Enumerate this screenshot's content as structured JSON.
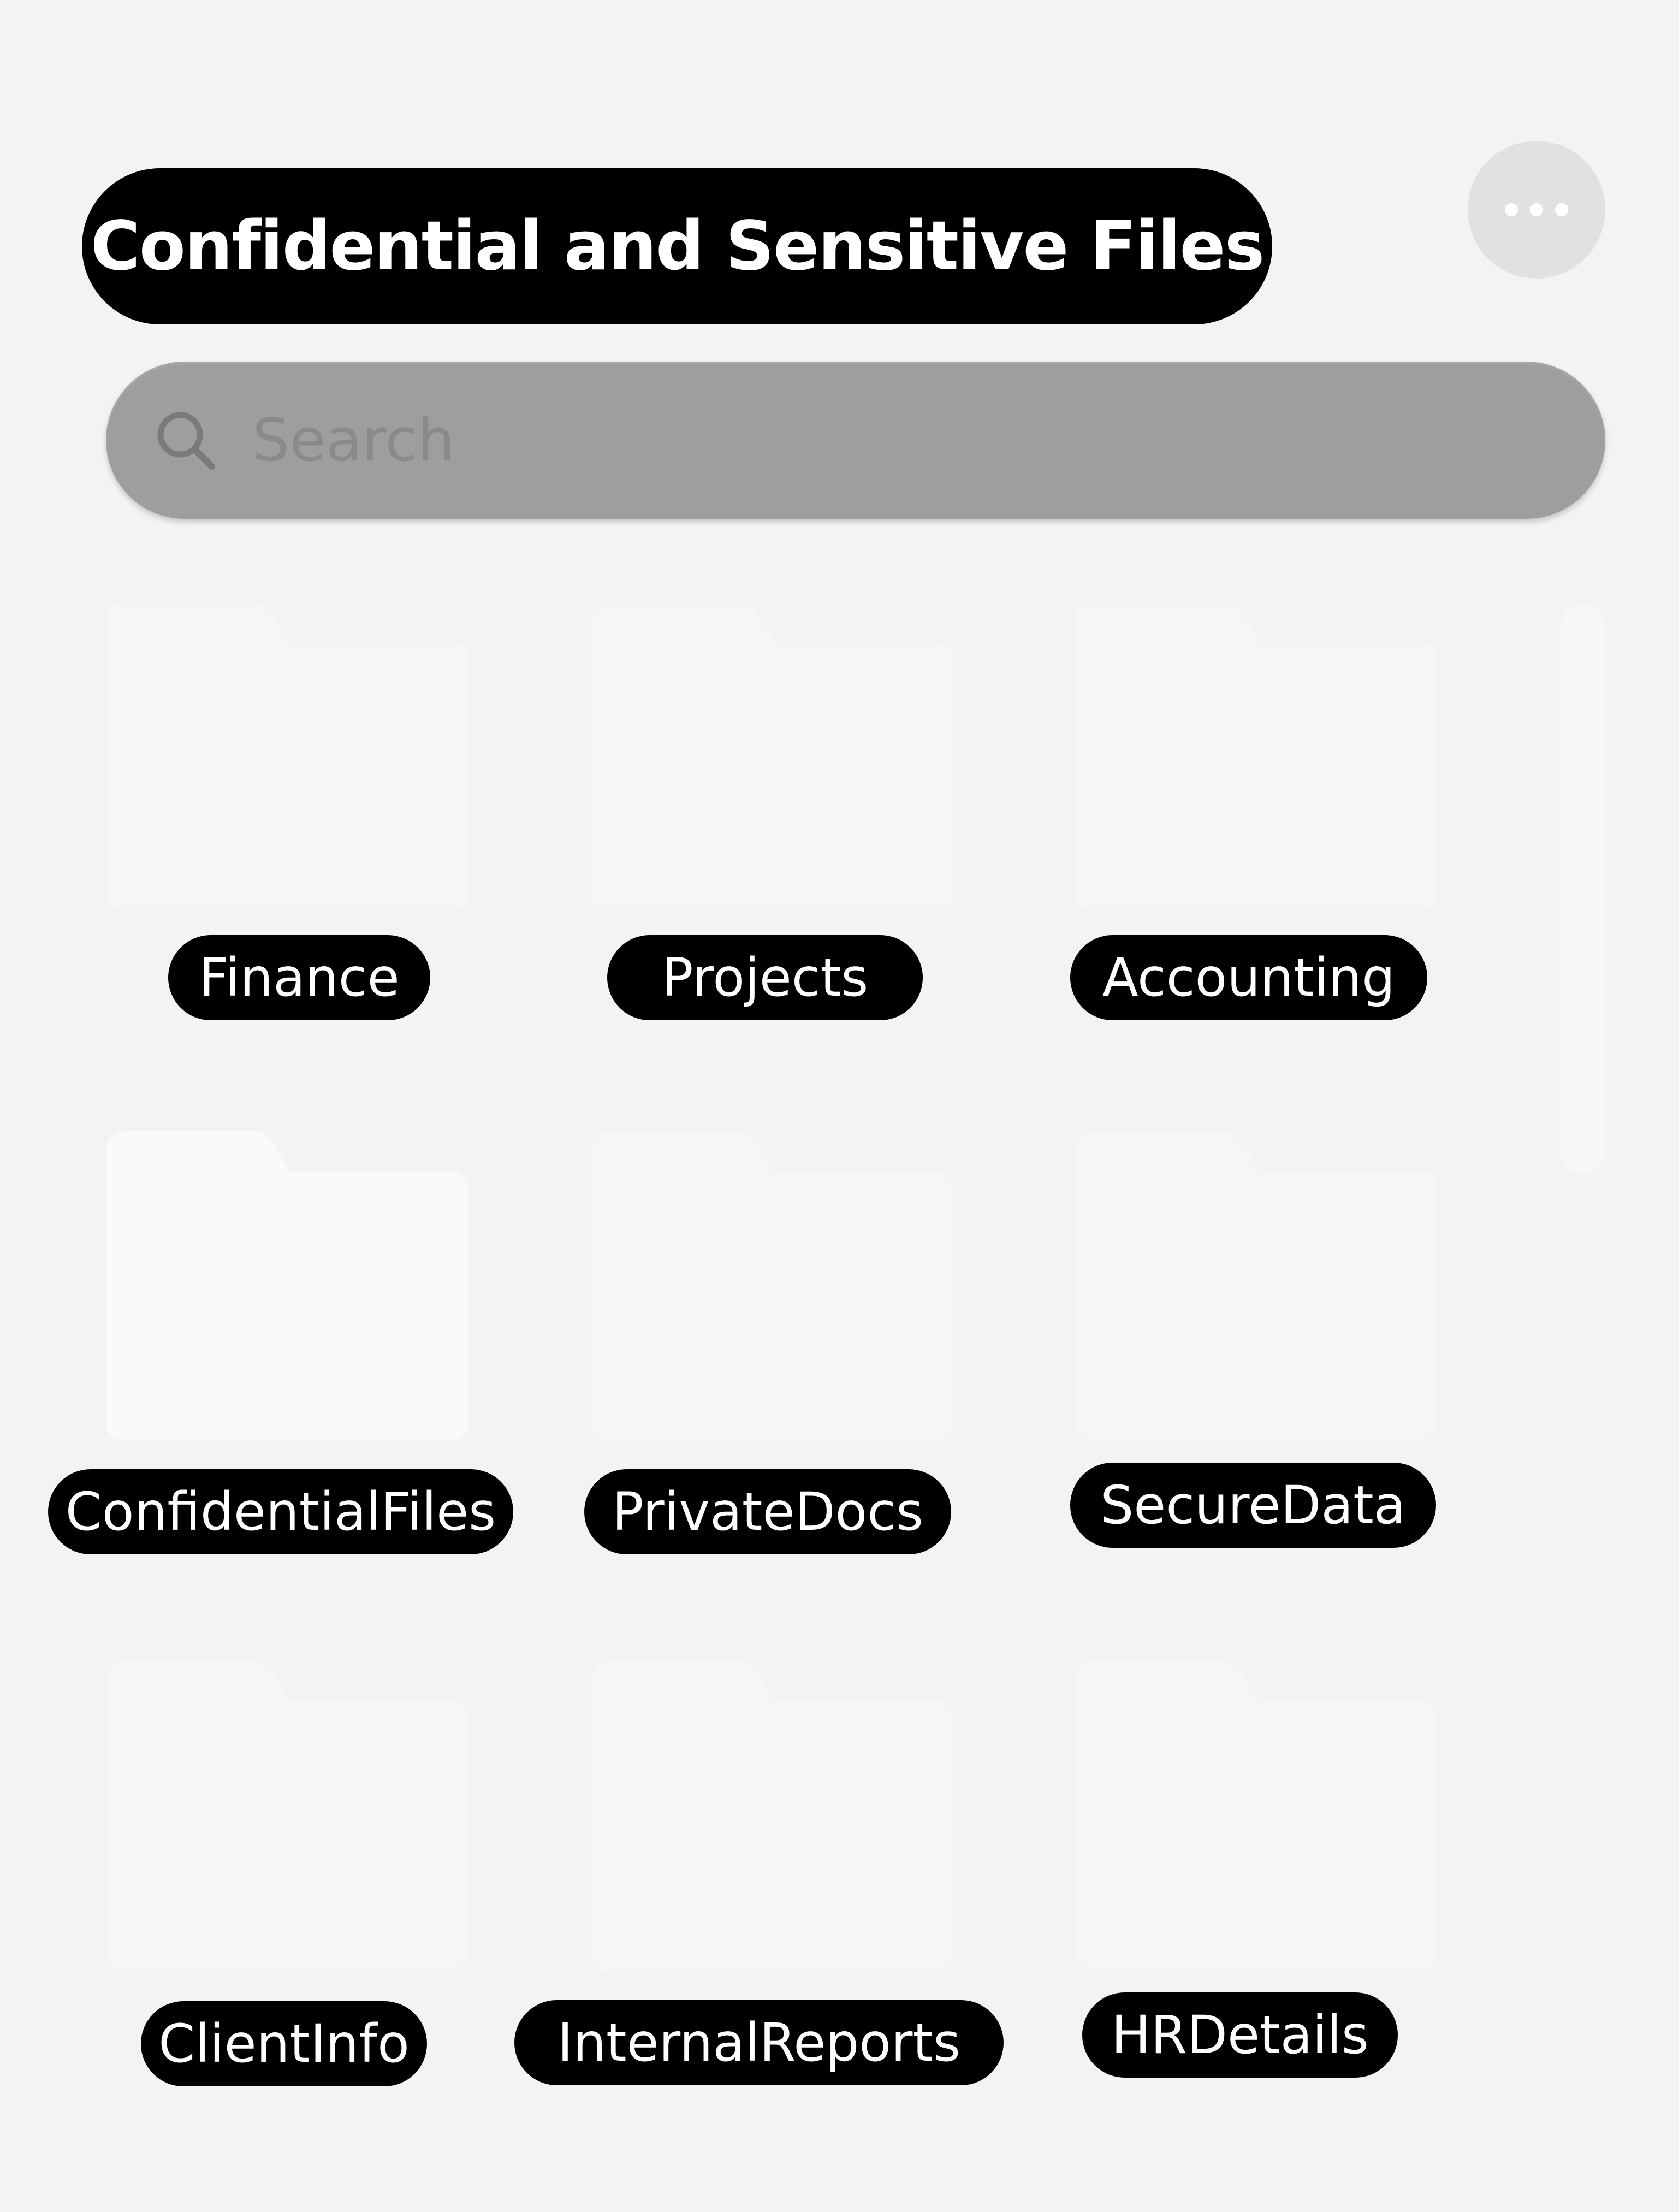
{
  "header": {
    "title": "Confidential and Sensitive Files"
  },
  "search": {
    "placeholder": "Search"
  },
  "folders": [
    {
      "label": "Finance"
    },
    {
      "label": "Projects"
    },
    {
      "label": "Accounting"
    },
    {
      "label": "ConfidentialFiles"
    },
    {
      "label": "PrivateDocs"
    },
    {
      "label": "SecureData"
    },
    {
      "label": "ClientInfo"
    },
    {
      "label": "InternalReports"
    },
    {
      "label": "HRDetails"
    }
  ],
  "icons": {
    "more": "more-horizontal-icon",
    "search": "search-icon",
    "folder": "folder-icon"
  },
  "colors": {
    "background": "#f3f3f3",
    "pill": "#000000",
    "search_bar": "#9e9e9e",
    "folder": "#f6f6f6"
  }
}
